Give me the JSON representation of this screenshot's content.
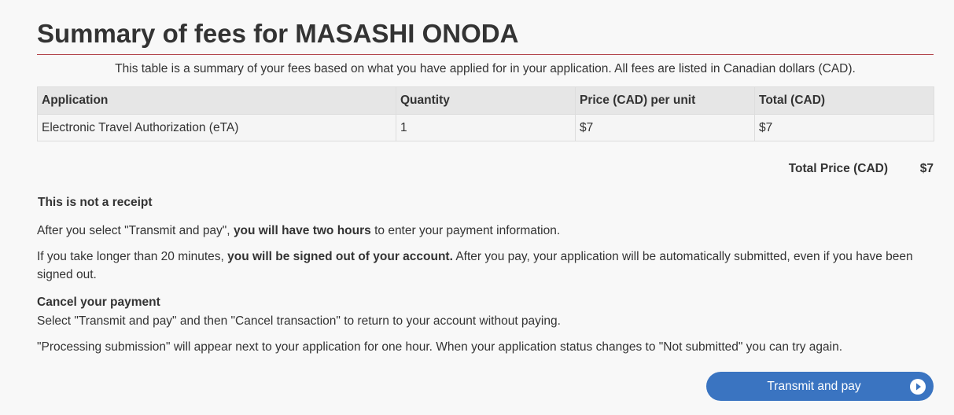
{
  "header": {
    "title": "Summary of fees for MASASHI ONODA"
  },
  "intro": "This table is a summary of your fees based on what you have applied for in your application. All fees are listed in Canadian dollars (CAD).",
  "table": {
    "headers": [
      "Application",
      "Quantity",
      "Price (CAD) per unit",
      "Total (CAD)"
    ],
    "rows": [
      [
        "Electronic Travel Authorization (eTA)",
        "1",
        "$7",
        "$7"
      ]
    ]
  },
  "total": {
    "label": "Total Price (CAD)",
    "value": "$7"
  },
  "notice": {
    "heading": "This is not a receipt",
    "p1_before": "After you select \"Transmit and pay\", ",
    "p1_bold": "you will have two hours",
    "p1_after": " to enter your payment information.",
    "p2_before": "If you take longer than 20 minutes, ",
    "p2_bold": "you will be signed out of your account.",
    "p2_after": " After you pay, your application will be automatically submitted, even if you have been signed out."
  },
  "cancel": {
    "heading": "Cancel your payment",
    "p3": "Select \"Transmit and pay\" and then \"Cancel transaction\" to return to your account without paying.",
    "p4": "\"Processing submission\" will appear next to your application for one hour. When your application status changes to \"Not submitted\" you can try again."
  },
  "actions": {
    "transmit_label": "Transmit and pay",
    "transmit_icon": "play-circle-icon"
  },
  "colors": {
    "accent": "#af3c43",
    "button": "#3a74c1",
    "text": "#333333"
  }
}
